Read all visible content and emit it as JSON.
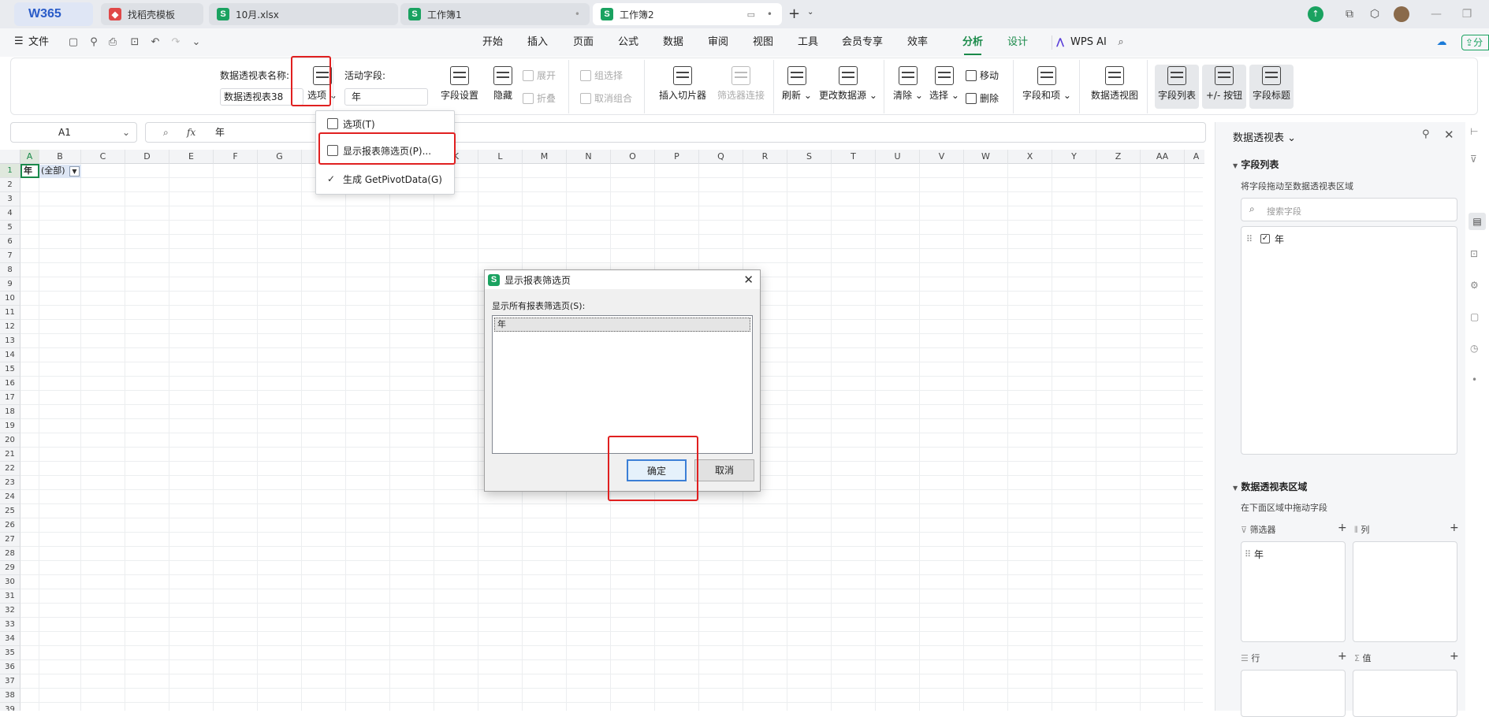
{
  "tabbar": {
    "logo": "W365",
    "tabs": [
      {
        "label": "找稻壳模板",
        "badge": "S"
      },
      {
        "label": "10月.xlsx",
        "badge": "S"
      },
      {
        "label": "工作簿1",
        "badge": "S"
      },
      {
        "label": "工作簿2",
        "badge": "S"
      }
    ],
    "add_label": "+"
  },
  "menubar": {
    "file_label": "文件",
    "tabs": [
      "开始",
      "插入",
      "页面",
      "公式",
      "数据",
      "审阅",
      "视图",
      "工具",
      "会员专享",
      "效率",
      "分析",
      "设计"
    ],
    "active_tab": "分析",
    "wps_ai": "WPS AI",
    "share_label": "分"
  },
  "ribbon": {
    "pivot_name_label": "数据透视表名称:",
    "pivot_name_value": "数据透视表38",
    "options_label": "选项",
    "active_field_label": "活动字段:",
    "active_field_value": "年",
    "field_settings": "字段设置",
    "hide": "隐藏",
    "expand": "展开",
    "collapse": "折叠",
    "group_selection": "组选择",
    "ungroup": "取消组合",
    "insert_slicer": "插入切片器",
    "filter_connection": "筛选器连接",
    "refresh": "刷新",
    "change_source": "更改数据源",
    "clear": "清除",
    "select": "选择",
    "move": "移动",
    "delete": "删除",
    "fields_items": "字段和项",
    "pivot_chart": "数据透视图",
    "field_list": "字段列表",
    "plus_minus_buttons": "+/- 按钮",
    "field_headers": "字段标题"
  },
  "formula": {
    "cell_ref": "A1",
    "fx": "fx",
    "value": "年"
  },
  "grid": {
    "columns": [
      "A",
      "B",
      "C",
      "D",
      "E",
      "F",
      "G",
      "H",
      "I",
      "J",
      "K",
      "L",
      "M",
      "N",
      "O",
      "P",
      "Q",
      "R",
      "S",
      "T",
      "U",
      "V",
      "W",
      "X",
      "Y",
      "Z",
      "AA",
      "A"
    ],
    "rows": [
      "1",
      "2",
      "3",
      "4",
      "5",
      "6",
      "7",
      "8",
      "9",
      "10",
      "11",
      "12",
      "13",
      "14",
      "15",
      "16",
      "17",
      "18",
      "19",
      "20",
      "21",
      "22",
      "23",
      "24",
      "25",
      "26",
      "27",
      "28",
      "29",
      "30",
      "31",
      "32",
      "33",
      "34",
      "35",
      "36",
      "37",
      "38",
      "39"
    ],
    "cell_a1": "年",
    "cell_b1": "(全部)"
  },
  "dropdown": {
    "items": [
      "选项(T)",
      "显示报表筛选页(P)...",
      "生成 GetPivotData(G)"
    ]
  },
  "dialog": {
    "title": "显示报表筛选页",
    "badge": "S",
    "list_label": "显示所有报表筛选页(S):",
    "list_items": [
      "年"
    ],
    "ok": "确定",
    "cancel": "取消"
  },
  "panel": {
    "title": "数据透视表",
    "field_list_title": "字段列表",
    "field_list_hint": "将字段拖动至数据透视表区域",
    "search_placeholder": "搜索字段",
    "fields": [
      "年"
    ],
    "areas_title": "数据透视表区域",
    "areas_hint": "在下面区域中拖动字段",
    "filters_label": "筛选器",
    "columns_label": "列",
    "rows_label": "行",
    "values_label": "值",
    "filter_item": "年"
  },
  "colors": {
    "accent": "#1a8a4a",
    "highlight_red": "#e02020",
    "sheet_badge": "#1aa260"
  }
}
